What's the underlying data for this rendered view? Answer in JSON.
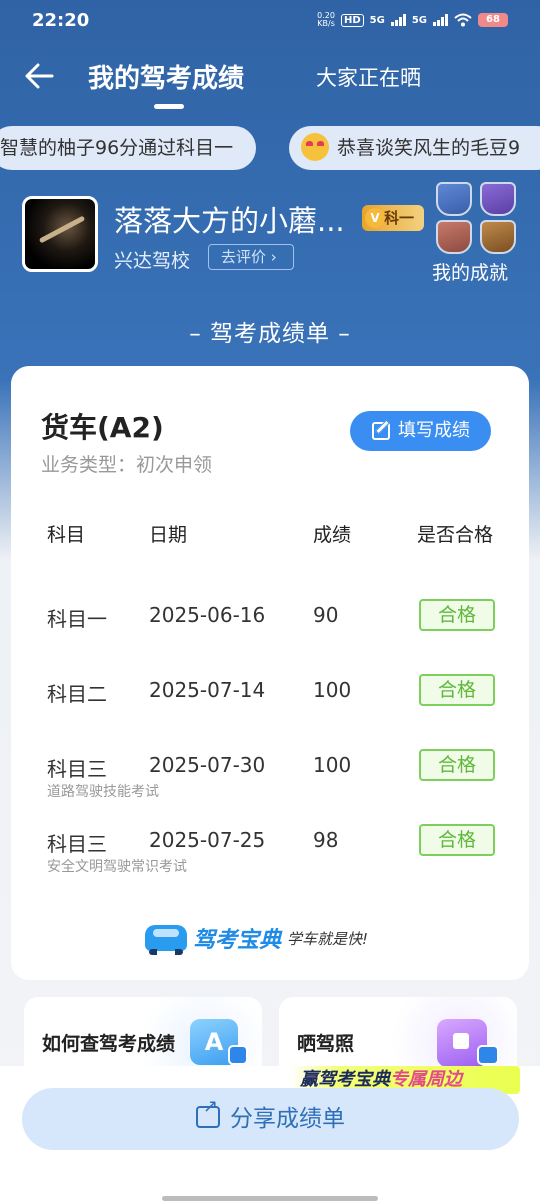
{
  "status": {
    "time": "22:20",
    "net_speed_top": "0.20",
    "net_speed_bottom": "KB/s",
    "hd": "HD",
    "net1": "5G",
    "net2": "5G",
    "battery": "68"
  },
  "header": {
    "tab_mine": "我的驾考成绩",
    "tab_others": "大家正在晒"
  },
  "ticker": [
    "智慧的柚子96分通过科目一",
    "恭喜谈笑风生的毛豆9"
  ],
  "profile": {
    "name": "落落大方的小蘑...",
    "level": "科一",
    "school": "兴达驾校",
    "rate_btn": "去评价",
    "achievement_label": "我的成就"
  },
  "section_title": "– 驾考成绩单 –",
  "card": {
    "vehicle": "货车(A2)",
    "biz_type": "业务类型：初次申领",
    "fill_btn": "填写成绩",
    "headers": [
      "科目",
      "日期",
      "成绩",
      "是否合格"
    ],
    "rows": [
      {
        "subject": "科目一",
        "date": "2025-06-16",
        "score": "90",
        "result": "合格",
        "note": ""
      },
      {
        "subject": "科目二",
        "date": "2025-07-14",
        "score": "100",
        "result": "合格",
        "note": ""
      },
      {
        "subject": "科目三",
        "date": "2025-07-30",
        "score": "100",
        "result": "合格",
        "note": "道路驾驶技能考试"
      },
      {
        "subject": "科目三",
        "date": "2025-07-25",
        "score": "98",
        "result": "合格",
        "note": "安全文明驾驶常识考试"
      }
    ],
    "brand_name": "驾考宝典",
    "brand_slogan": "学车就是快!"
  },
  "mini_cards": {
    "check_score": "如何查驾考成绩",
    "az_letter": "A",
    "show_license": "晒驾照"
  },
  "promo": {
    "prefix": "赢驾考宝典",
    "highlight": "专属周边"
  },
  "share_btn": "分享成绩单",
  "colors": {
    "header_blue": "#2f63a5",
    "accent_blue": "#3a8ef2",
    "pass_green": "#5fb83a"
  }
}
